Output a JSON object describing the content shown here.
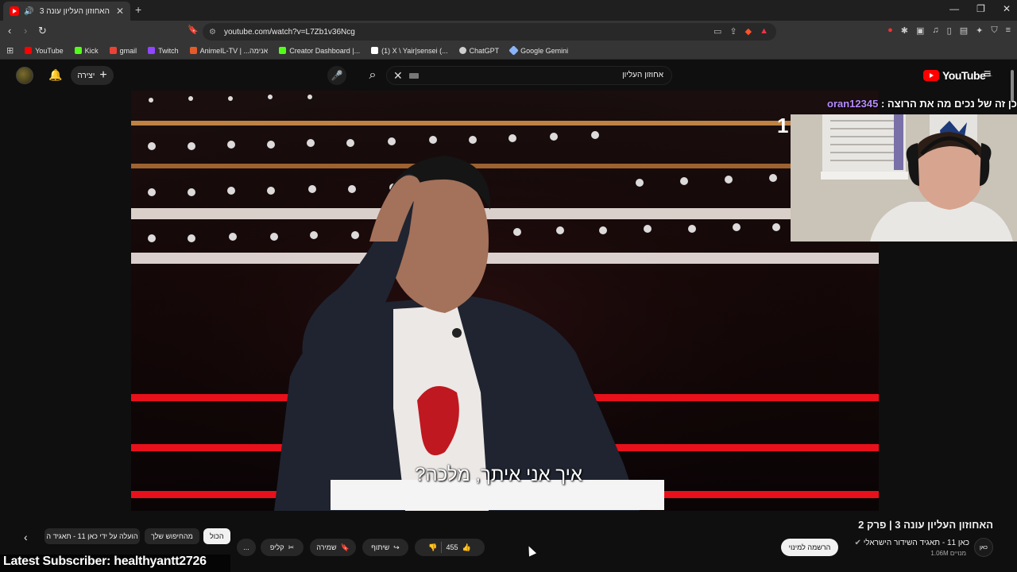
{
  "browser": {
    "tab_title": "האחוזון העליון עונה 3 | פרק 2",
    "tab_close": "✕",
    "new_tab": "+",
    "url": "youtube.com/watch?v=L7Zb1v36Ncg",
    "window_controls": [
      "—",
      "❐",
      "✕"
    ],
    "bookmarks": [
      {
        "label": "YouTube",
        "color": "#ff0000"
      },
      {
        "label": "Kick",
        "color": "#53fc18"
      },
      {
        "label": "gmail",
        "color": "#ea4335"
      },
      {
        "label": "Twitch",
        "color": "#9146ff"
      },
      {
        "label": "AnimeIL-TV | ...אנימה",
        "color": "#e35b2a"
      },
      {
        "label": "Creator Dashboard |...",
        "color": "#53fc18"
      },
      {
        "label": "(1) X \\ Yair|sensei (...",
        "color": "#ffffff"
      },
      {
        "label": "ChatGPT",
        "color": "#cfcfcf"
      },
      {
        "label": "Google Gemini",
        "color": "#8ab4f8"
      }
    ]
  },
  "youtube": {
    "create_label": "יצירה",
    "search_query": "אחוזון העליון",
    "logo_text": "YouTube",
    "logo_sup": "IL"
  },
  "video": {
    "subtitle": "איך אני איתך, מלכה?"
  },
  "stream_overlay": {
    "chat_user": "oran12345",
    "chat_message": "כן זה של נכים מה את הרוצה :",
    "corner_number": "1",
    "latest_subscriber": "Latest Subscriber: healthyantt2726"
  },
  "video_info": {
    "title": "האחוזון העליון עונה 3 | פרק 2",
    "channel": "כאן 11 - תאגיד השידור הישראלי",
    "subscribers": "1.06M מנויים",
    "channel_logo_text": "כאן",
    "subscribe_label": "הרשמה למינוי",
    "likes": "455",
    "share_label": "שיתוף",
    "save_label": "שמירה",
    "clip_label": "קליפ",
    "more_label": "..."
  },
  "chips": [
    {
      "label": "הכול",
      "selected": true
    },
    {
      "label": "מהחיפוש שלך",
      "selected": false
    },
    {
      "label": "הועלה על ידי כאן 11 - תאגיד ה",
      "selected": false
    }
  ]
}
